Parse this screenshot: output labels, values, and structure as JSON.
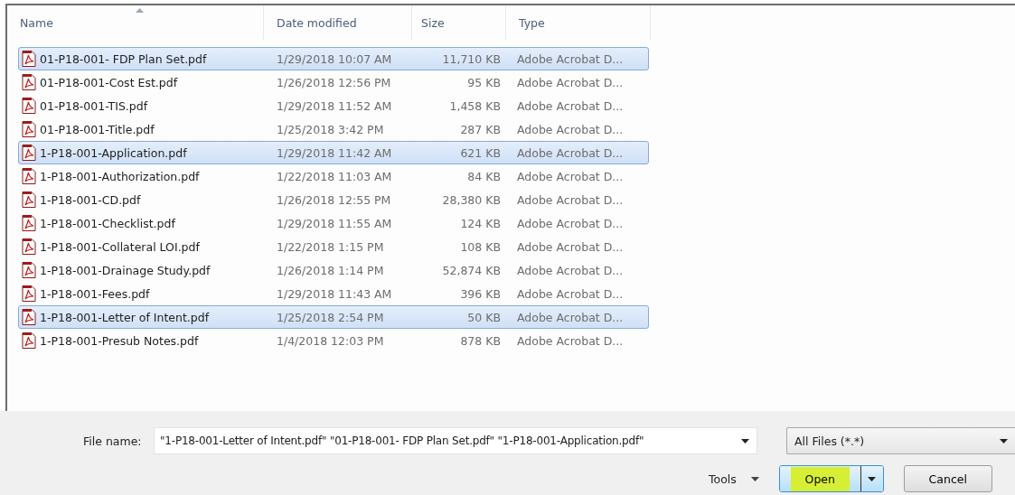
{
  "columns": [
    {
      "label": "Name",
      "sorted": true
    },
    {
      "label": "Date modified",
      "sorted": false
    },
    {
      "label": "Size",
      "sorted": false
    },
    {
      "label": "Type",
      "sorted": false
    }
  ],
  "rows": [
    {
      "name": "01-P18-001- FDP Plan Set.pdf",
      "date": "1/29/2018 10:07 AM",
      "size": "11,710 KB",
      "type": "Adobe Acrobat D...",
      "selected": true
    },
    {
      "name": "01-P18-001-Cost Est.pdf",
      "date": "1/26/2018 12:56 PM",
      "size": "95 KB",
      "type": "Adobe Acrobat D...",
      "selected": false
    },
    {
      "name": "01-P18-001-TIS.pdf",
      "date": "1/29/2018 11:52 AM",
      "size": "1,458 KB",
      "type": "Adobe Acrobat D...",
      "selected": false
    },
    {
      "name": "01-P18-001-Title.pdf",
      "date": "1/25/2018 3:42 PM",
      "size": "287 KB",
      "type": "Adobe Acrobat D...",
      "selected": false
    },
    {
      "name": "1-P18-001-Application.pdf",
      "date": "1/29/2018 11:42 AM",
      "size": "621 KB",
      "type": "Adobe Acrobat D...",
      "selected": true
    },
    {
      "name": "1-P18-001-Authorization.pdf",
      "date": "1/22/2018 11:03 AM",
      "size": "84 KB",
      "type": "Adobe Acrobat D...",
      "selected": false
    },
    {
      "name": "1-P18-001-CD.pdf",
      "date": "1/26/2018 12:55 PM",
      "size": "28,380 KB",
      "type": "Adobe Acrobat D...",
      "selected": false
    },
    {
      "name": "1-P18-001-Checklist.pdf",
      "date": "1/29/2018 11:55 AM",
      "size": "124 KB",
      "type": "Adobe Acrobat D...",
      "selected": false
    },
    {
      "name": "1-P18-001-Collateral LOI.pdf",
      "date": "1/22/2018 1:15 PM",
      "size": "108 KB",
      "type": "Adobe Acrobat D...",
      "selected": false
    },
    {
      "name": "1-P18-001-Drainage Study.pdf",
      "date": "1/26/2018 1:14 PM",
      "size": "52,874 KB",
      "type": "Adobe Acrobat D...",
      "selected": false
    },
    {
      "name": "1-P18-001-Fees.pdf",
      "date": "1/29/2018 11:43 AM",
      "size": "396 KB",
      "type": "Adobe Acrobat D...",
      "selected": false
    },
    {
      "name": "1-P18-001-Letter of Intent.pdf",
      "date": "1/25/2018 2:54 PM",
      "size": "50 KB",
      "type": "Adobe Acrobat D...",
      "selected": true
    },
    {
      "name": "1-P18-001-Presub Notes.pdf",
      "date": "1/4/2018 12:03 PM",
      "size": "878 KB",
      "type": "Adobe Acrobat D...",
      "selected": false
    }
  ],
  "file_name": {
    "label": "File name:",
    "value": "\"1-P18-001-Letter of Intent.pdf\" \"01-P18-001- FDP Plan Set.pdf\" \"1-P18-001-Application.pdf\""
  },
  "file_type": {
    "value": "All Files (*.*)"
  },
  "buttons": {
    "tools": "Tools",
    "open": "Open",
    "cancel": "Cancel"
  }
}
